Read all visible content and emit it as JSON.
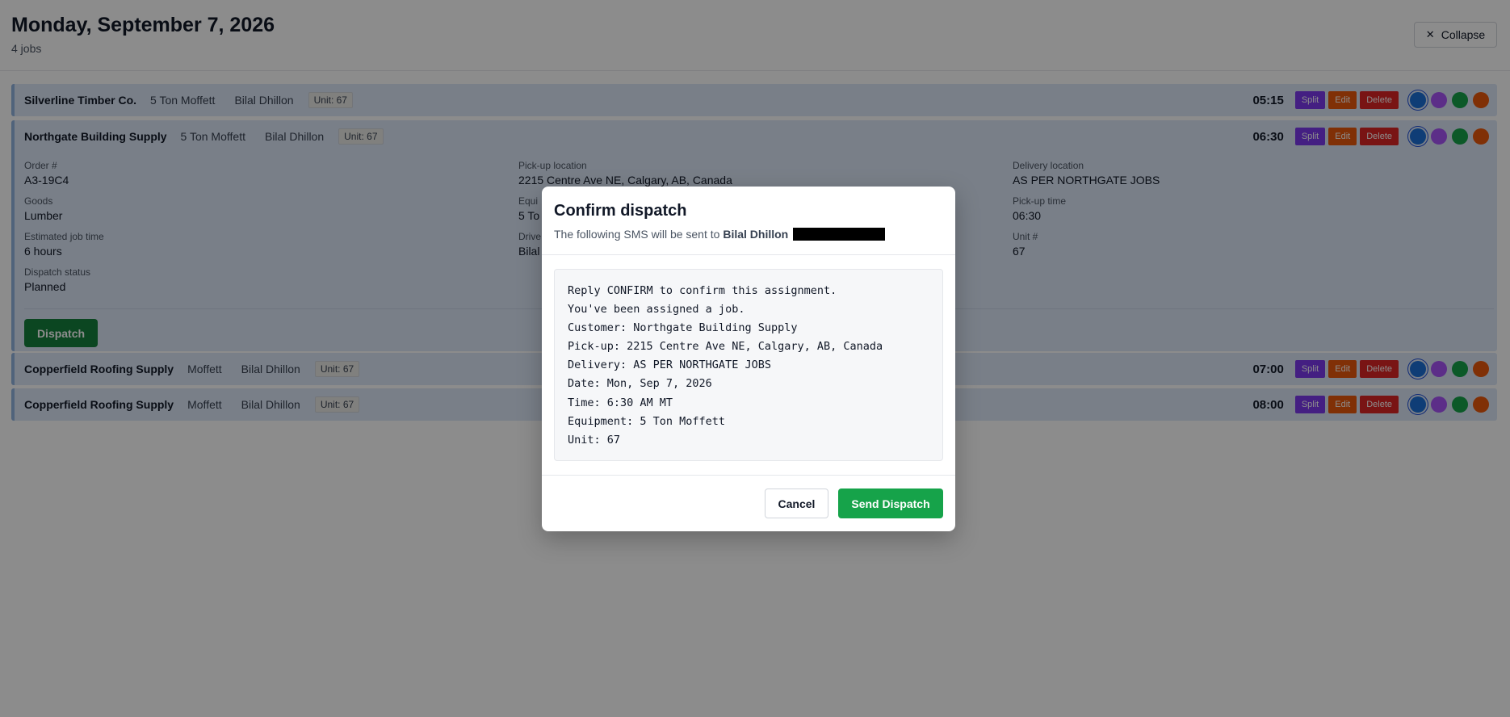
{
  "header": {
    "title": "Monday, September 7, 2026",
    "subtitle": "4 jobs",
    "collapse_label": "Collapse",
    "collapse_icon": "close-icon"
  },
  "jobs": [
    {
      "customer": "Silverline Timber Co.",
      "equipment": "5 Ton Moffett",
      "driver": "Bilal Dhillon",
      "unit": "Unit: 67",
      "time": "05:15",
      "split": "Split",
      "edit": "Edit",
      "delete": "Delete"
    },
    {
      "customer": "Northgate Building Supply",
      "equipment": "5 Ton Moffett",
      "driver": "Bilal Dhillon",
      "unit": "Unit: 67",
      "time": "06:30",
      "split": "Split",
      "edit": "Edit",
      "delete": "Delete",
      "details": {
        "order_label": "Order #",
        "order_value": "A3-19C4",
        "goods_label": "Goods",
        "goods_value": "Lumber",
        "est_label": "Estimated job time",
        "est_value": "6 hours",
        "status_label": "Dispatch status",
        "status_value": "Planned",
        "pickup_loc_label": "Pick-up location",
        "pickup_loc_value": "2215 Centre Ave NE, Calgary, AB, Canada",
        "equip_label": "Equi",
        "equip_value": "5 To",
        "driver_label": "Drive",
        "driver_value": "Bilal",
        "delivery_label": "Delivery location",
        "delivery_value": "AS PER NORTHGATE JOBS",
        "pickup_time_label": "Pick-up time",
        "pickup_time_value": "06:30",
        "unit_label": "Unit #",
        "unit_value": "67"
      },
      "dispatch_label": "Dispatch"
    },
    {
      "customer": "Copperfield Roofing Supply",
      "equipment": "Moffett",
      "driver": "Bilal Dhillon",
      "unit": "Unit: 67",
      "time": "07:00",
      "split": "Split",
      "edit": "Edit",
      "delete": "Delete"
    },
    {
      "customer": "Copperfield Roofing Supply",
      "equipment": "Moffett",
      "driver": "Bilal Dhillon",
      "unit": "Unit: 67",
      "time": "08:00",
      "split": "Split",
      "edit": "Edit",
      "delete": "Delete"
    }
  ],
  "status_colors": [
    "#1d6fd8",
    "#a855f7",
    "#16a34a",
    "#ea580c"
  ],
  "modal": {
    "title": "Confirm dispatch",
    "subtitle_prefix": "The following SMS will be sent to",
    "recipient": "Bilal Dhillon",
    "sms_lines": [
      "Reply CONFIRM to confirm this assignment.",
      "You've been assigned a job.",
      "Customer: Northgate Building Supply",
      "Pick-up: 2215 Centre Ave NE, Calgary, AB, Canada",
      "Delivery: AS PER NORTHGATE JOBS",
      "Date: Mon, Sep 7, 2026",
      "Time: 6:30 AM MT",
      "Equipment: 5 Ton Moffett",
      "Unit: 67"
    ],
    "cancel_label": "Cancel",
    "send_label": "Send Dispatch"
  }
}
